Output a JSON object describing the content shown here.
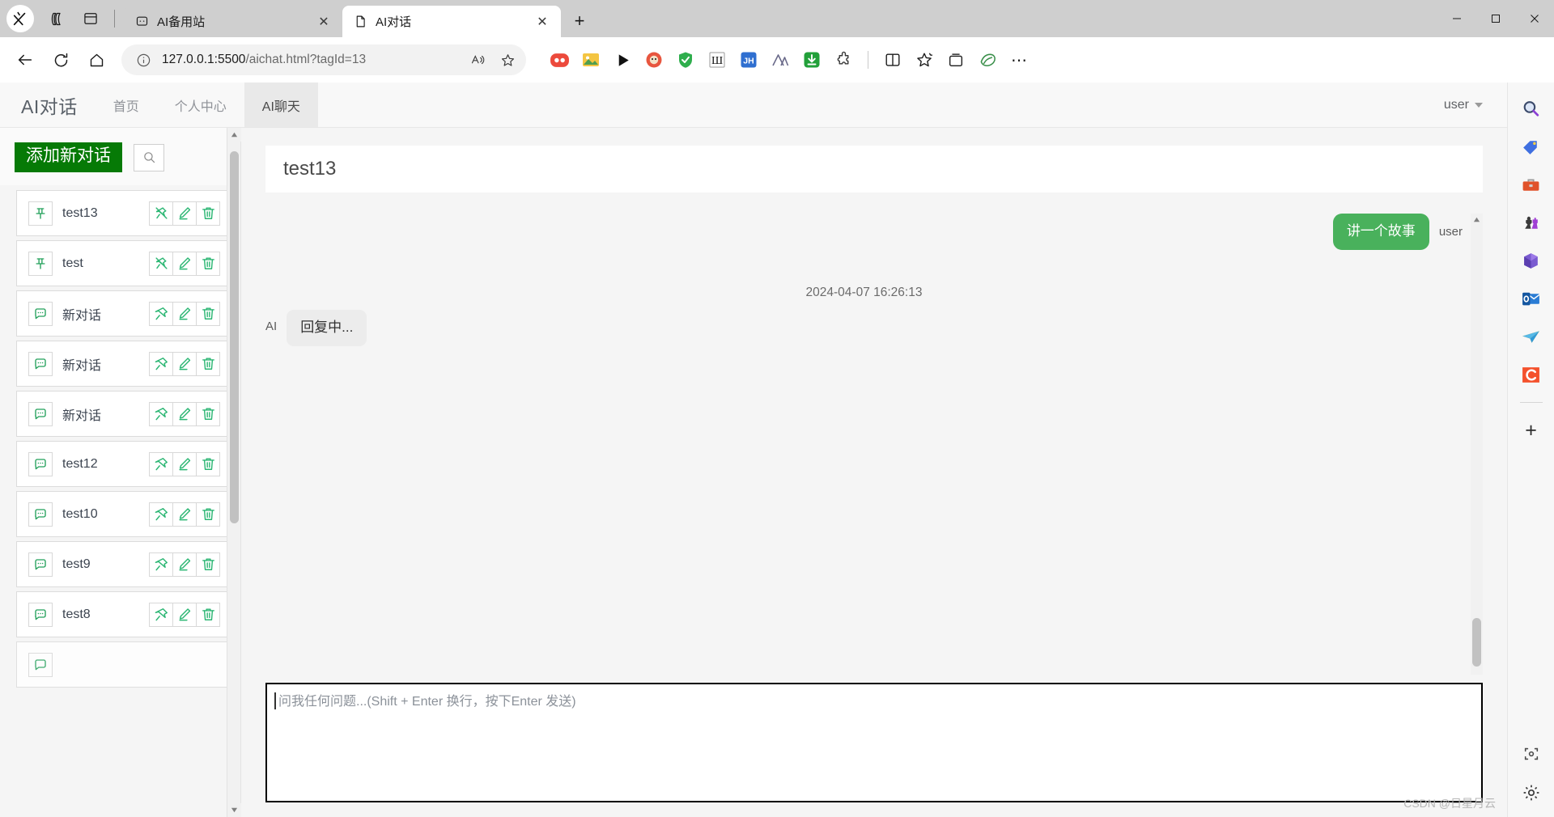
{
  "browser": {
    "tabs": [
      {
        "title": "AI备用站",
        "active": false,
        "favicon": "chat-favicon",
        "close_label": "✕"
      },
      {
        "title": "AI对话",
        "active": true,
        "favicon": "document-favicon",
        "close_label": "✕"
      }
    ],
    "new_tab_label": "+",
    "window_controls": {
      "minimize": "—",
      "maximize": "▢",
      "close": "✕"
    },
    "toolbar": {
      "back_label": "←",
      "refresh_label": "⟳",
      "home_label": "⌂",
      "url_host": "127.0.0.1:5500",
      "url_path": "/aichat.html?tagId=13",
      "read_aloud_label": "A",
      "favorite_label": "☆",
      "more_label": "⋯"
    },
    "extensions": [
      "dots-extension-icon",
      "image-extension-icon",
      "play-extension-icon",
      "emoji-extension-icon",
      "shield-extension-icon",
      "ublock-extension-icon",
      "jh-extension-icon",
      "arc-extension-icon",
      "download-extension-icon",
      "puzzle-extension-icon",
      "split-screen-icon",
      "collections-icon",
      "favorites-icon",
      "browser-essentials-icon"
    ]
  },
  "app": {
    "brand": "AI对话",
    "nav_items": [
      {
        "label": "首页",
        "active": false
      },
      {
        "label": "个人中心",
        "active": false
      },
      {
        "label": "AI聊天",
        "active": true
      }
    ],
    "user_label": "user"
  },
  "sidebar": {
    "add_button_label": "添加新对话",
    "search_placeholder": "",
    "conversations": [
      {
        "name": "test13",
        "pinned": true
      },
      {
        "name": "test",
        "pinned": true
      },
      {
        "name": "新对话",
        "pinned": false
      },
      {
        "name": "新对话",
        "pinned": false
      },
      {
        "name": "新对话",
        "pinned": false
      },
      {
        "name": "test12",
        "pinned": false
      },
      {
        "name": "test10",
        "pinned": false
      },
      {
        "name": "test9",
        "pinned": false
      },
      {
        "name": "test8",
        "pinned": false
      }
    ]
  },
  "chat": {
    "title": "test13",
    "timestamp": "2024-04-07 16:26:13",
    "messages": [
      {
        "role": "user",
        "role_label": "user",
        "text": "讲一个故事"
      },
      {
        "role": "ai",
        "role_label": "AI",
        "text": "回复中..."
      }
    ],
    "input_placeholder": "问我任何问题...(Shift + Enter 换行，按下Enter 发送)",
    "input_value": ""
  },
  "rail": {
    "items": [
      {
        "name": "search-icon",
        "glyph": "🔍"
      },
      {
        "name": "shopping-tag-icon",
        "glyph": "🏷"
      },
      {
        "name": "tools-icon",
        "glyph": "🧰"
      },
      {
        "name": "games-icon",
        "glyph": "♟"
      },
      {
        "name": "microsoft365-icon",
        "glyph": ""
      },
      {
        "name": "outlook-icon",
        "glyph": ""
      },
      {
        "name": "telegram-icon",
        "glyph": ""
      },
      {
        "name": "app-c-icon",
        "glyph": "C"
      }
    ],
    "add_label": "+",
    "screenshot_label": "⛶",
    "settings_label": "⚙"
  },
  "watermark": "CSDN @日星月云",
  "colors": {
    "accent_green": "#067a06",
    "bubble_green": "#49b15c",
    "icon_green": "#2bb673",
    "tab_bar": "#cfcfcf"
  }
}
